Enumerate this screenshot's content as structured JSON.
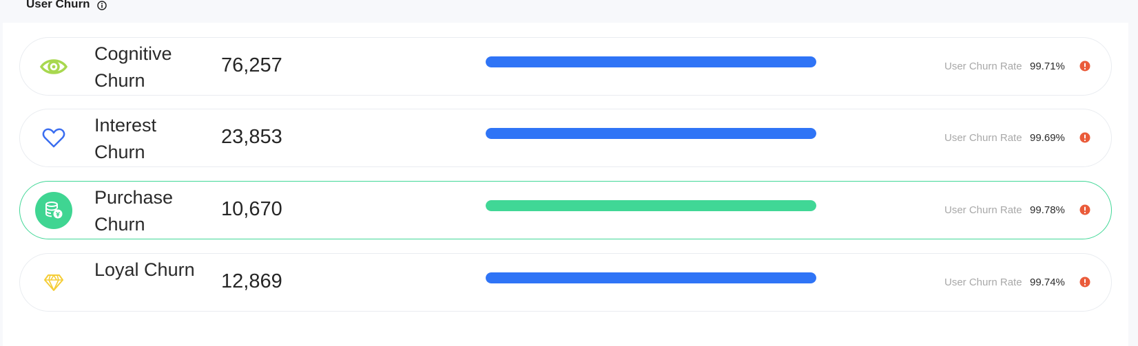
{
  "header": {
    "title": "User Churn",
    "info_icon": "info-circle-icon"
  },
  "rows": [
    {
      "name": "Cognitive Churn",
      "count": "76,257",
      "icon": "eye-icon",
      "icon_color": "#a8d84f",
      "bar_fraction": 1.0,
      "bar_color": "#2f74f6",
      "rate_label": "User Churn Rate",
      "rate": "99.71%",
      "alert_icon": "warning-icon"
    },
    {
      "name": "Interest Churn",
      "count": "23,853",
      "icon": "heart-icon",
      "icon_color": "#3a6df0",
      "bar_fraction": 1.0,
      "bar_color": "#2f74f6",
      "rate_label": "User Churn Rate",
      "rate": "99.69%",
      "alert_icon": "warning-icon"
    },
    {
      "name": "Purchase Churn",
      "count": "10,670",
      "icon": "coins-icon",
      "icon_color": "#3fd592",
      "bar_fraction": 1.0,
      "bar_color": "#40d796",
      "rate_label": "User Churn Rate",
      "rate": "99.78%",
      "alert_icon": "warning-icon",
      "selected": true
    },
    {
      "name": "Loyal Churn",
      "count": "12,869",
      "icon": "diamond-icon",
      "icon_color": "#f5cd36",
      "bar_fraction": 1.0,
      "bar_color": "#2f74f6",
      "rate_label": "User Churn Rate",
      "rate": "99.74%",
      "alert_icon": "warning-icon"
    }
  ],
  "colors": {
    "alert": "#ea5b3a",
    "selected_border": "#40d796"
  }
}
